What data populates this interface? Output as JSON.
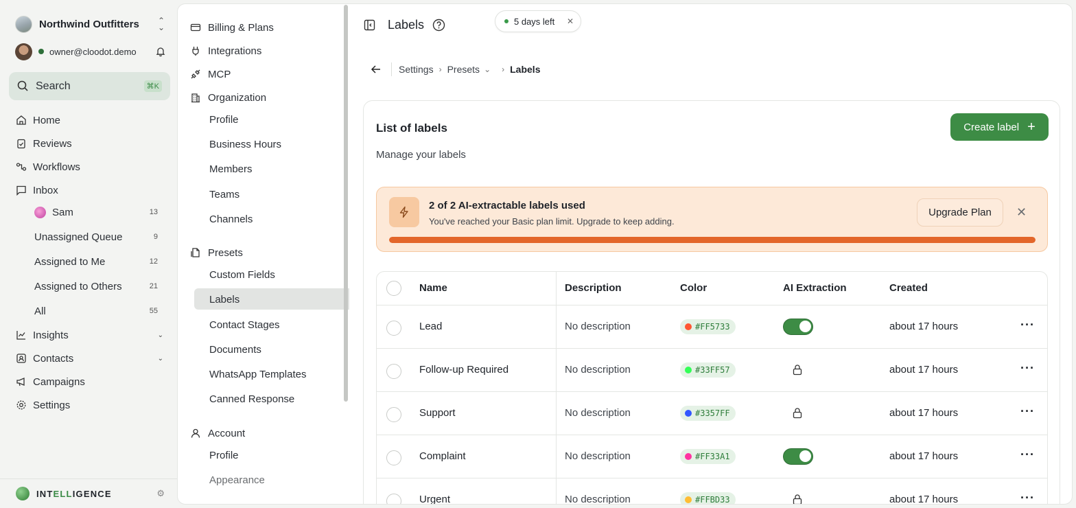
{
  "sidebar": {
    "workspace": "Northwind Outfitters",
    "owner_email": "owner@cloodot.demo",
    "search_label": "Search",
    "search_shortcut": "⌘K",
    "nav": {
      "home": "Home",
      "reviews": "Reviews",
      "workflows": "Workflows",
      "inbox": "Inbox",
      "insights": "Insights",
      "contacts": "Contacts",
      "campaigns": "Campaigns",
      "settings": "Settings"
    },
    "inbox_items": [
      {
        "label": "Sam",
        "count": "13"
      },
      {
        "label": "Unassigned Queue",
        "count": "9"
      },
      {
        "label": "Assigned to Me",
        "count": "12"
      },
      {
        "label": "Assigned to Others",
        "count": "21"
      },
      {
        "label": "All",
        "count": "55"
      }
    ],
    "brand_a": "INT",
    "brand_b": "ELL",
    "brand_c": "IGENCE"
  },
  "settings_nav": {
    "billing": "Billing & Plans",
    "integrations": "Integrations",
    "mcp": "MCP",
    "organization": "Organization",
    "org_items": [
      "Profile",
      "Business Hours",
      "Members",
      "Teams",
      "Channels"
    ],
    "presets": "Presets",
    "preset_items": [
      "Custom Fields",
      "Labels",
      "Contact Stages",
      "Documents",
      "WhatsApp Templates",
      "Canned Response"
    ],
    "account": "Account",
    "account_items": [
      "Profile",
      "Appearance"
    ]
  },
  "header": {
    "title": "Labels",
    "trial": "5 days left"
  },
  "breadcrumb": {
    "settings": "Settings",
    "presets": "Presets",
    "current": "Labels"
  },
  "card": {
    "title": "List of labels",
    "subtitle": "Manage your labels",
    "create_label": "Create label"
  },
  "banner": {
    "title": "2 of 2 AI-extractable labels used",
    "message": "You've reached your Basic plan limit. Upgrade to keep adding.",
    "upgrade": "Upgrade Plan",
    "progress": 1.0
  },
  "table": {
    "columns": {
      "name": "Name",
      "description": "Description",
      "color": "Color",
      "ai": "AI Extraction",
      "created": "Created"
    },
    "rows": [
      {
        "name": "Lead",
        "description": "No description",
        "color": "#FF5733",
        "ai": "on",
        "created": "about 17 hours"
      },
      {
        "name": "Follow-up Required",
        "description": "No description",
        "color": "#33FF57",
        "ai": "locked",
        "created": "about 17 hours"
      },
      {
        "name": "Support",
        "description": "No description",
        "color": "#3357FF",
        "ai": "locked",
        "created": "about 17 hours"
      },
      {
        "name": "Complaint",
        "description": "No description",
        "color": "#FF33A1",
        "ai": "on",
        "created": "about 17 hours"
      },
      {
        "name": "Urgent",
        "description": "No description",
        "color": "#FFBD33",
        "ai": "locked",
        "created": "about 17 hours"
      }
    ]
  },
  "colors": {
    "accent": "#3d8c45",
    "banner_bg": "#fde9d8",
    "progress": "#e3662a"
  }
}
